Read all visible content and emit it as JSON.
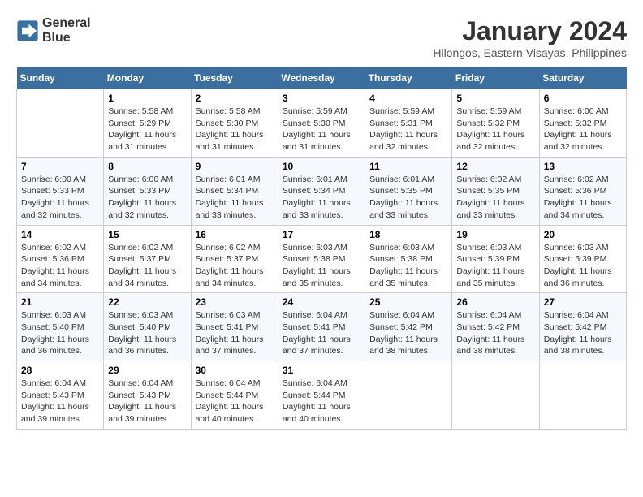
{
  "header": {
    "logo_line1": "General",
    "logo_line2": "Blue",
    "month": "January 2024",
    "location": "Hilongos, Eastern Visayas, Philippines"
  },
  "weekdays": [
    "Sunday",
    "Monday",
    "Tuesday",
    "Wednesday",
    "Thursday",
    "Friday",
    "Saturday"
  ],
  "weeks": [
    [
      {
        "day": "",
        "sunrise": "",
        "sunset": "",
        "daylight": ""
      },
      {
        "day": "1",
        "sunrise": "Sunrise: 5:58 AM",
        "sunset": "Sunset: 5:29 PM",
        "daylight": "Daylight: 11 hours and 31 minutes."
      },
      {
        "day": "2",
        "sunrise": "Sunrise: 5:58 AM",
        "sunset": "Sunset: 5:30 PM",
        "daylight": "Daylight: 11 hours and 31 minutes."
      },
      {
        "day": "3",
        "sunrise": "Sunrise: 5:59 AM",
        "sunset": "Sunset: 5:30 PM",
        "daylight": "Daylight: 11 hours and 31 minutes."
      },
      {
        "day": "4",
        "sunrise": "Sunrise: 5:59 AM",
        "sunset": "Sunset: 5:31 PM",
        "daylight": "Daylight: 11 hours and 32 minutes."
      },
      {
        "day": "5",
        "sunrise": "Sunrise: 5:59 AM",
        "sunset": "Sunset: 5:32 PM",
        "daylight": "Daylight: 11 hours and 32 minutes."
      },
      {
        "day": "6",
        "sunrise": "Sunrise: 6:00 AM",
        "sunset": "Sunset: 5:32 PM",
        "daylight": "Daylight: 11 hours and 32 minutes."
      }
    ],
    [
      {
        "day": "7",
        "sunrise": "Sunrise: 6:00 AM",
        "sunset": "Sunset: 5:33 PM",
        "daylight": "Daylight: 11 hours and 32 minutes."
      },
      {
        "day": "8",
        "sunrise": "Sunrise: 6:00 AM",
        "sunset": "Sunset: 5:33 PM",
        "daylight": "Daylight: 11 hours and 32 minutes."
      },
      {
        "day": "9",
        "sunrise": "Sunrise: 6:01 AM",
        "sunset": "Sunset: 5:34 PM",
        "daylight": "Daylight: 11 hours and 33 minutes."
      },
      {
        "day": "10",
        "sunrise": "Sunrise: 6:01 AM",
        "sunset": "Sunset: 5:34 PM",
        "daylight": "Daylight: 11 hours and 33 minutes."
      },
      {
        "day": "11",
        "sunrise": "Sunrise: 6:01 AM",
        "sunset": "Sunset: 5:35 PM",
        "daylight": "Daylight: 11 hours and 33 minutes."
      },
      {
        "day": "12",
        "sunrise": "Sunrise: 6:02 AM",
        "sunset": "Sunset: 5:35 PM",
        "daylight": "Daylight: 11 hours and 33 minutes."
      },
      {
        "day": "13",
        "sunrise": "Sunrise: 6:02 AM",
        "sunset": "Sunset: 5:36 PM",
        "daylight": "Daylight: 11 hours and 34 minutes."
      }
    ],
    [
      {
        "day": "14",
        "sunrise": "Sunrise: 6:02 AM",
        "sunset": "Sunset: 5:36 PM",
        "daylight": "Daylight: 11 hours and 34 minutes."
      },
      {
        "day": "15",
        "sunrise": "Sunrise: 6:02 AM",
        "sunset": "Sunset: 5:37 PM",
        "daylight": "Daylight: 11 hours and 34 minutes."
      },
      {
        "day": "16",
        "sunrise": "Sunrise: 6:02 AM",
        "sunset": "Sunset: 5:37 PM",
        "daylight": "Daylight: 11 hours and 34 minutes."
      },
      {
        "day": "17",
        "sunrise": "Sunrise: 6:03 AM",
        "sunset": "Sunset: 5:38 PM",
        "daylight": "Daylight: 11 hours and 35 minutes."
      },
      {
        "day": "18",
        "sunrise": "Sunrise: 6:03 AM",
        "sunset": "Sunset: 5:38 PM",
        "daylight": "Daylight: 11 hours and 35 minutes."
      },
      {
        "day": "19",
        "sunrise": "Sunrise: 6:03 AM",
        "sunset": "Sunset: 5:39 PM",
        "daylight": "Daylight: 11 hours and 35 minutes."
      },
      {
        "day": "20",
        "sunrise": "Sunrise: 6:03 AM",
        "sunset": "Sunset: 5:39 PM",
        "daylight": "Daylight: 11 hours and 36 minutes."
      }
    ],
    [
      {
        "day": "21",
        "sunrise": "Sunrise: 6:03 AM",
        "sunset": "Sunset: 5:40 PM",
        "daylight": "Daylight: 11 hours and 36 minutes."
      },
      {
        "day": "22",
        "sunrise": "Sunrise: 6:03 AM",
        "sunset": "Sunset: 5:40 PM",
        "daylight": "Daylight: 11 hours and 36 minutes."
      },
      {
        "day": "23",
        "sunrise": "Sunrise: 6:03 AM",
        "sunset": "Sunset: 5:41 PM",
        "daylight": "Daylight: 11 hours and 37 minutes."
      },
      {
        "day": "24",
        "sunrise": "Sunrise: 6:04 AM",
        "sunset": "Sunset: 5:41 PM",
        "daylight": "Daylight: 11 hours and 37 minutes."
      },
      {
        "day": "25",
        "sunrise": "Sunrise: 6:04 AM",
        "sunset": "Sunset: 5:42 PM",
        "daylight": "Daylight: 11 hours and 38 minutes."
      },
      {
        "day": "26",
        "sunrise": "Sunrise: 6:04 AM",
        "sunset": "Sunset: 5:42 PM",
        "daylight": "Daylight: 11 hours and 38 minutes."
      },
      {
        "day": "27",
        "sunrise": "Sunrise: 6:04 AM",
        "sunset": "Sunset: 5:42 PM",
        "daylight": "Daylight: 11 hours and 38 minutes."
      }
    ],
    [
      {
        "day": "28",
        "sunrise": "Sunrise: 6:04 AM",
        "sunset": "Sunset: 5:43 PM",
        "daylight": "Daylight: 11 hours and 39 minutes."
      },
      {
        "day": "29",
        "sunrise": "Sunrise: 6:04 AM",
        "sunset": "Sunset: 5:43 PM",
        "daylight": "Daylight: 11 hours and 39 minutes."
      },
      {
        "day": "30",
        "sunrise": "Sunrise: 6:04 AM",
        "sunset": "Sunset: 5:44 PM",
        "daylight": "Daylight: 11 hours and 40 minutes."
      },
      {
        "day": "31",
        "sunrise": "Sunrise: 6:04 AM",
        "sunset": "Sunset: 5:44 PM",
        "daylight": "Daylight: 11 hours and 40 minutes."
      },
      {
        "day": "",
        "sunrise": "",
        "sunset": "",
        "daylight": ""
      },
      {
        "day": "",
        "sunrise": "",
        "sunset": "",
        "daylight": ""
      },
      {
        "day": "",
        "sunrise": "",
        "sunset": "",
        "daylight": ""
      }
    ]
  ]
}
